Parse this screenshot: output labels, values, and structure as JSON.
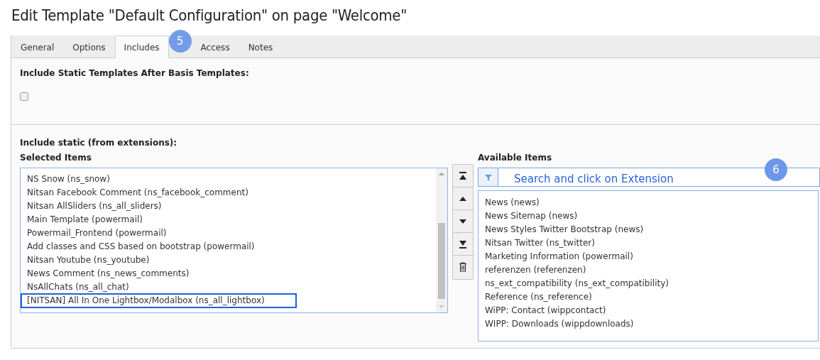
{
  "page_title": "Edit Template \"Default Configuration\" on page \"Welcome\"",
  "tabs": [
    {
      "label": "General",
      "selected": false
    },
    {
      "label": "Options",
      "selected": false
    },
    {
      "label": "Includes",
      "selected": true
    },
    {
      "label": "Access",
      "selected": false
    },
    {
      "label": "Notes",
      "selected": false
    }
  ],
  "tab_badge": {
    "text": "5"
  },
  "basis_section": {
    "label": "Include Static Templates After Basis Templates:",
    "checked": false
  },
  "static_section": {
    "label": "Include static (from extensions):",
    "selected_items": {
      "label": "Selected Items",
      "items": [
        {
          "text": "NS Snow (ns_snow)",
          "highlighted": false
        },
        {
          "text": "Nitsan Facebook Comment (ns_facebook_comment)",
          "highlighted": false
        },
        {
          "text": "Nitsan AllSliders (ns_all_sliders)",
          "highlighted": false
        },
        {
          "text": "Main Template (powermail)",
          "highlighted": false
        },
        {
          "text": "Powermail_Frontend (powermail)",
          "highlighted": false
        },
        {
          "text": "Add classes and CSS based on bootstrap (powermail)",
          "highlighted": false
        },
        {
          "text": "Nitsan Youtube (ns_youtube)",
          "highlighted": false
        },
        {
          "text": "News Comment (ns_news_comments)",
          "highlighted": false
        },
        {
          "text": "NsAllChats (ns_all_chat)",
          "highlighted": false
        },
        {
          "text": "[NITSAN] All In One Lightbox/Modalbox (ns_all_lightbox)",
          "highlighted": true
        }
      ]
    },
    "available_items": {
      "label": "Available Items",
      "search": {
        "placeholder": "Search and click on Extension"
      },
      "badge": "6",
      "items": [
        "News (news)",
        "News Sitemap (news)",
        "News Styles Twitter Bootstrap (news)",
        "Nitsan Twitter (ns_twitter)",
        "Marketing Information (powermail)",
        "referenzen (referenzen)",
        "ns_ext_compatibility (ns_ext_compatibility)",
        "Reference (ns_reference)",
        "WiPP: Contact (wippcontact)",
        "WIPP: Downloads (wippdownloads)"
      ]
    }
  }
}
